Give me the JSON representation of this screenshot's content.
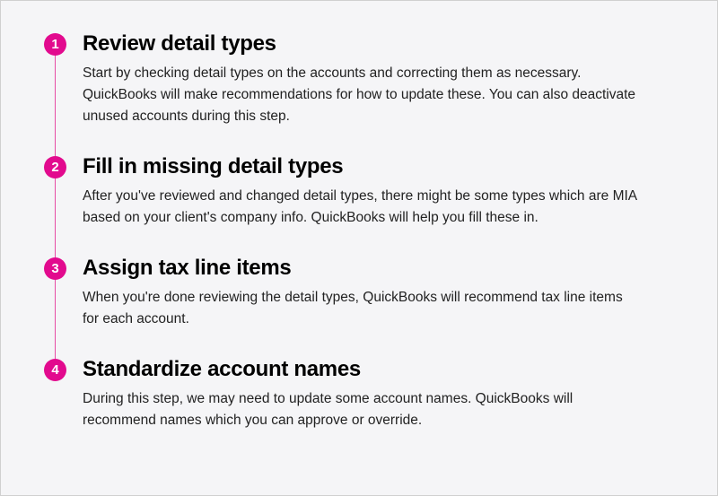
{
  "steps": [
    {
      "number": "1",
      "title": "Review detail types",
      "description": "Start by checking detail types on the accounts and correcting them as necessary. QuickBooks will make recommendations for how to update these. You can also deactivate unused accounts during this step."
    },
    {
      "number": "2",
      "title": "Fill in missing detail types",
      "description": "After you've reviewed and changed detail types, there might be some types which are MIA based on your client's company info. QuickBooks will help you fill these in."
    },
    {
      "number": "3",
      "title": "Assign tax line items",
      "description": "When you're done reviewing the detail types, QuickBooks will recommend tax line items for each account."
    },
    {
      "number": "4",
      "title": "Standardize account names",
      "description": "During this step, we may need to update some account names. QuickBooks will recommend names which you can approve or override."
    }
  ]
}
